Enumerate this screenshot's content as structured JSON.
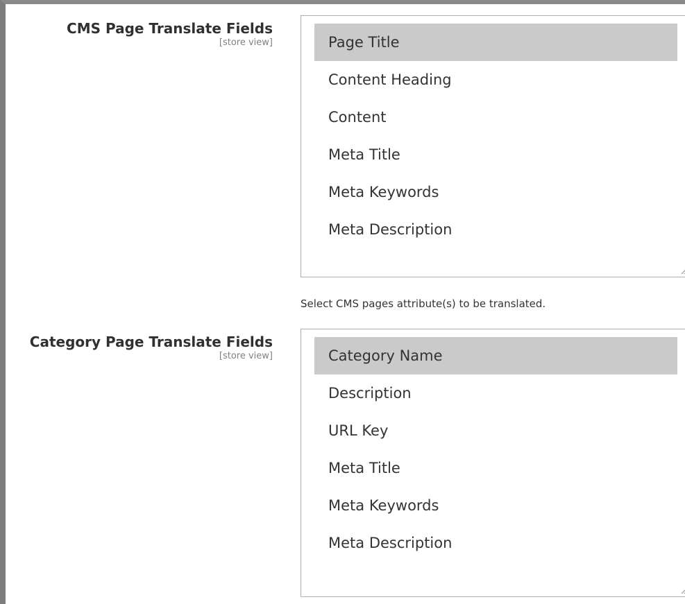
{
  "cms_field": {
    "label": "CMS Page Translate Fields",
    "scope": "[store view]",
    "options": [
      {
        "label": "Page Title",
        "selected": true
      },
      {
        "label": "Content Heading",
        "selected": false
      },
      {
        "label": "Content",
        "selected": false
      },
      {
        "label": "Meta Title",
        "selected": false
      },
      {
        "label": "Meta Keywords",
        "selected": false
      },
      {
        "label": "Meta Description",
        "selected": false
      }
    ],
    "note": "Select CMS pages attribute(s) to be translated."
  },
  "category_field": {
    "label": "Category Page Translate Fields",
    "scope": "[store view]",
    "options": [
      {
        "label": "Category Name",
        "selected": true
      },
      {
        "label": "Description",
        "selected": false
      },
      {
        "label": "URL Key",
        "selected": false
      },
      {
        "label": "Meta Title",
        "selected": false
      },
      {
        "label": "Meta Keywords",
        "selected": false
      },
      {
        "label": "Meta Description",
        "selected": false
      }
    ]
  },
  "colors": {
    "selected_option_bg": "#cacaca",
    "select_border": "#adadad",
    "frame_border": "#7d7d7d"
  }
}
